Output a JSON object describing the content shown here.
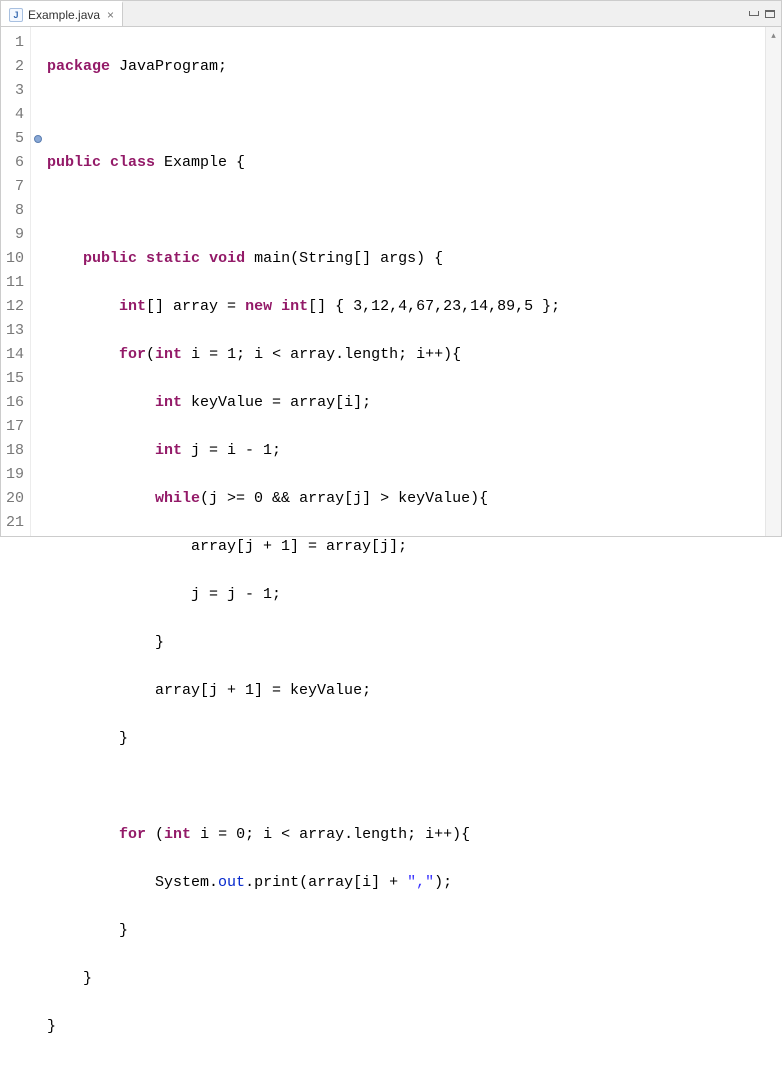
{
  "tab": {
    "file_icon_label": "J",
    "filename": "Example.java",
    "close_glyph": "×"
  },
  "gutter": {
    "lines": [
      "1",
      "2",
      "3",
      "4",
      "5",
      "6",
      "7",
      "8",
      "9",
      "10",
      "11",
      "12",
      "13",
      "14",
      "15",
      "16",
      "17",
      "18",
      "19",
      "20",
      "21"
    ],
    "marker_line": 5
  },
  "code": {
    "l1_kw": "package",
    "l1_rest": " JavaProgram;",
    "l3_kw1": "public",
    "l3_kw2": "class",
    "l3_rest": " Example {",
    "l5_kw1": "public",
    "l5_kw2": "static",
    "l5_kw3": "void",
    "l5_rest": " main(String[] args) {",
    "l6_kw1": "int",
    "l6_mid": "[] array = ",
    "l6_kw2": "new",
    "l6_kw3": "int",
    "l6_rest": "[] { 3,12,4,67,23,14,89,5 };",
    "l7_kw1": "for",
    "l7_p1": "(",
    "l7_kw2": "int",
    "l7_rest": " i = 1; i < array.length; i++){",
    "l8_kw": "int",
    "l8_rest": " keyValue = array[i];",
    "l9_kw": "int",
    "l9_rest": " j = i - 1;",
    "l10_kw": "while",
    "l10_rest": "(j >= 0 && array[j] > keyValue){",
    "l11": "array[j + 1] = array[j];",
    "l12": "j = j - 1;",
    "l13": "}",
    "l14": "array[j + 1] = keyValue;",
    "l15": "}",
    "l17_kw1": "for",
    "l17_p1": " (",
    "l17_kw2": "int",
    "l17_rest": " i = 0; i < array.length; i++){",
    "l18_a": "System.",
    "l18_out": "out",
    "l18_b": ".print(array[i] + ",
    "l18_str": "\",\"",
    "l18_c": ");",
    "l19": "}",
    "l20": "}",
    "l21": "}"
  },
  "scroll": {
    "up": "▴",
    "down": "▾"
  }
}
